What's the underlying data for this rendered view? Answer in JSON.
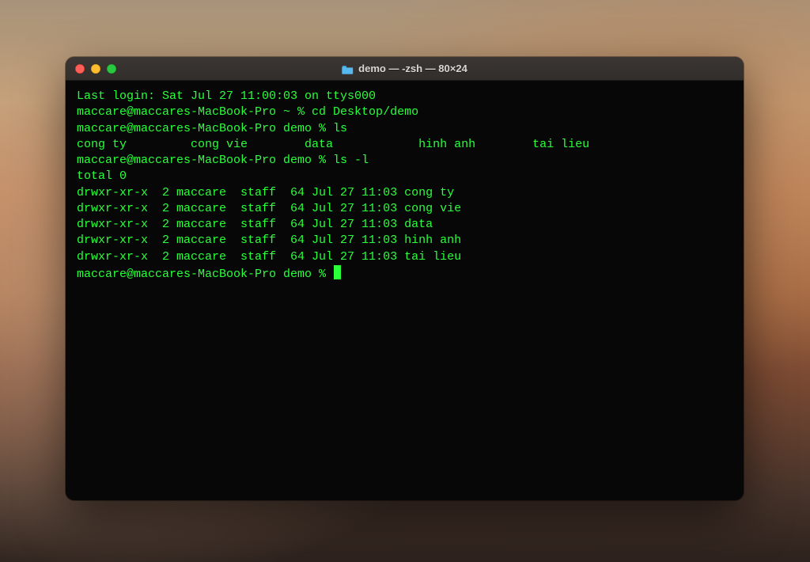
{
  "window": {
    "title": "demo — -zsh — 80×24"
  },
  "terminal": {
    "lines": [
      "Last login: Sat Jul 27 11:00:03 on ttys000",
      "maccare@maccares-MacBook-Pro ~ % cd Desktop/demo",
      "maccare@maccares-MacBook-Pro demo % ls",
      "cong ty         cong vie        data            hinh anh        tai lieu",
      "maccare@maccares-MacBook-Pro demo % ls -l",
      "total 0",
      "drwxr-xr-x  2 maccare  staff  64 Jul 27 11:03 cong ty",
      "drwxr-xr-x  2 maccare  staff  64 Jul 27 11:03 cong vie",
      "drwxr-xr-x  2 maccare  staff  64 Jul 27 11:03 data",
      "drwxr-xr-x  2 maccare  staff  64 Jul 27 11:03 hinh anh",
      "drwxr-xr-x  2 maccare  staff  64 Jul 27 11:03 tai lieu"
    ],
    "prompt": "maccare@maccares-MacBook-Pro demo % "
  }
}
